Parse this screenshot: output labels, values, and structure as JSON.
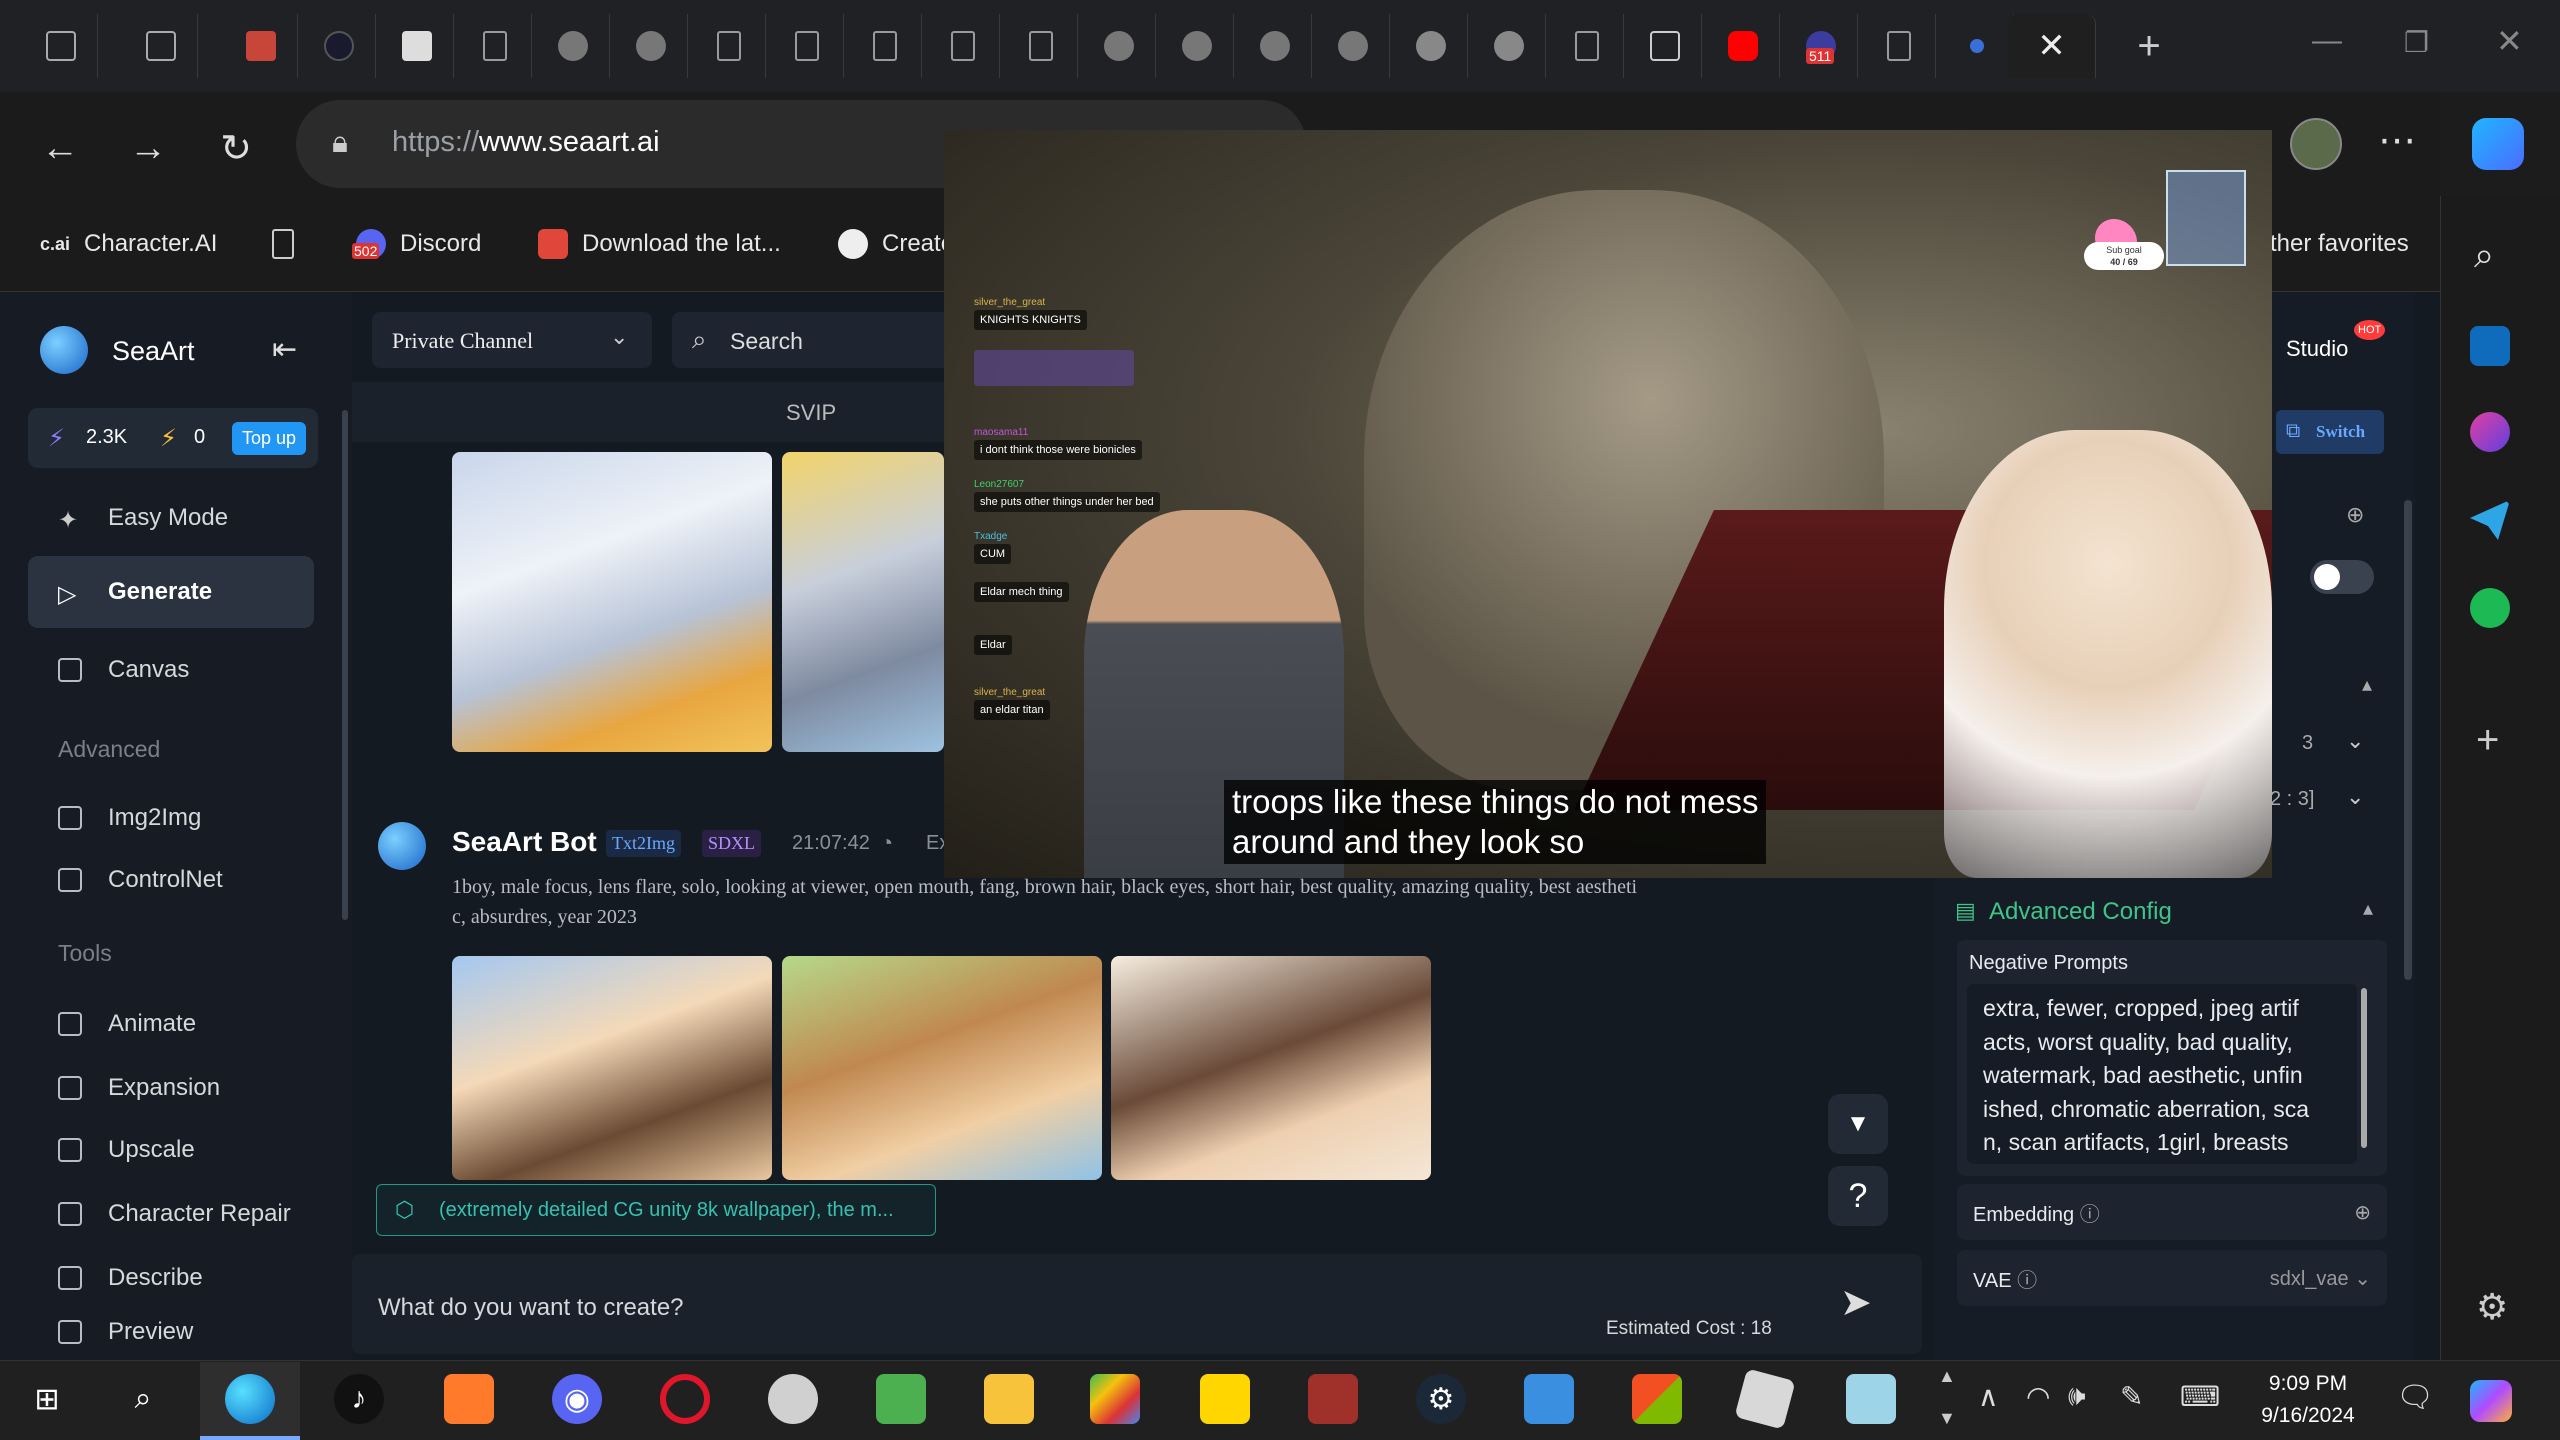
{
  "browser": {
    "url_prefix": "https://",
    "url_domain": "www.seaart.ai",
    "favorites": [
      {
        "label": "Character.AI",
        "icon_text": "c.ai"
      },
      {
        "label": "",
        "icon": "document-icon"
      },
      {
        "label": "Discord",
        "badge": "502"
      },
      {
        "label": "Download the lat..."
      },
      {
        "label": "Create"
      }
    ],
    "other_favorites": "ther favorites",
    "tab_badge": "511"
  },
  "app": {
    "brand": "SeaArt",
    "stats": {
      "stamina": "2.3K",
      "power": "0",
      "topup": "Top up"
    },
    "nav": [
      {
        "label": "Easy Mode",
        "icon": "sparkle-icon"
      },
      {
        "label": "Generate",
        "icon": "play-icon",
        "active": true
      },
      {
        "label": "Canvas",
        "icon": "canvas-icon"
      }
    ],
    "sections": {
      "advanced": "Advanced",
      "tools": "Tools"
    },
    "advanced_items": [
      {
        "label": "Img2Img",
        "icon": "img2img-icon"
      },
      {
        "label": "ControlNet",
        "icon": "sliders-icon"
      }
    ],
    "tools_items": [
      {
        "label": "Animate",
        "icon": "animate-icon"
      },
      {
        "label": "Expansion",
        "icon": "expansion-icon"
      },
      {
        "label": "Upscale",
        "icon": "hd-icon"
      },
      {
        "label": "Character Repair",
        "icon": "repair-icon"
      },
      {
        "label": "Describe",
        "icon": "book-icon"
      },
      {
        "label": "Preview",
        "icon": "preview-icon"
      }
    ],
    "channel": "Private Channel",
    "search_placeholder": "Search",
    "svip": "SVIP",
    "studio": "Studio",
    "hot": "HOT",
    "switch": "Switch",
    "message": {
      "author": "SeaArt Bot",
      "tags": [
        "Txt2Img",
        "SDXL"
      ],
      "time": "21:07:42",
      "more": "Ex",
      "prompt": "1boy, male focus, lens flare, solo, looking at viewer, open mouth, fang, brown hair, black eyes, short hair, best quality, amazing quality, best aestheti\nc, absurdres, year 2023"
    },
    "prompt_chip": "(extremely detailed CG unity 8k wallpaper), the m...",
    "input_placeholder": "What do you want to create?",
    "cost_label": "Estimated Cost : 18",
    "panel": {
      "value_a": "3",
      "value_b": "2 : 3]",
      "advanced_config": "Advanced Config",
      "negative_label": "Negative Prompts",
      "negative_text": "extra, fewer, cropped, jpeg artif\nacts, worst quality, bad quality,\nwatermark, bad aesthetic, unfin\nished, chromatic aberration, sca\nn, scan artifacts, 1girl, breasts",
      "embedding": "Embedding",
      "vae": "VAE",
      "vae_value": "sdxl_vae"
    }
  },
  "video": {
    "subtitle": "troops like these things do not mess\naround and they look so",
    "sub_goal": "Sub goal",
    "sub_count": "40 / 69",
    "chat": [
      {
        "user": "silver_the_great",
        "msg": "KNIGHTS KNIGHTS",
        "color": "#d9b44a"
      },
      {
        "user": "",
        "msg": "",
        "color": "#9aa"
      },
      {
        "user": "maosama11",
        "msg": "i dont think those were bionicles",
        "color": "#c456d9"
      },
      {
        "user": "Leon27607",
        "msg": "she puts other things under her bed",
        "color": "#40d06a"
      },
      {
        "user": "Txadge",
        "msg": "CUM",
        "color": "#4ac0e0"
      },
      {
        "user": "",
        "msg": "Eldar mech thing",
        "color": "#e04040"
      },
      {
        "user": "",
        "msg": "Eldar",
        "color": "#9aa"
      },
      {
        "user": "silver_the_great",
        "msg": "an eldar titan",
        "color": "#d9b44a"
      }
    ]
  },
  "taskbar": {
    "time": "9:09 PM",
    "date": "9/16/2024"
  }
}
